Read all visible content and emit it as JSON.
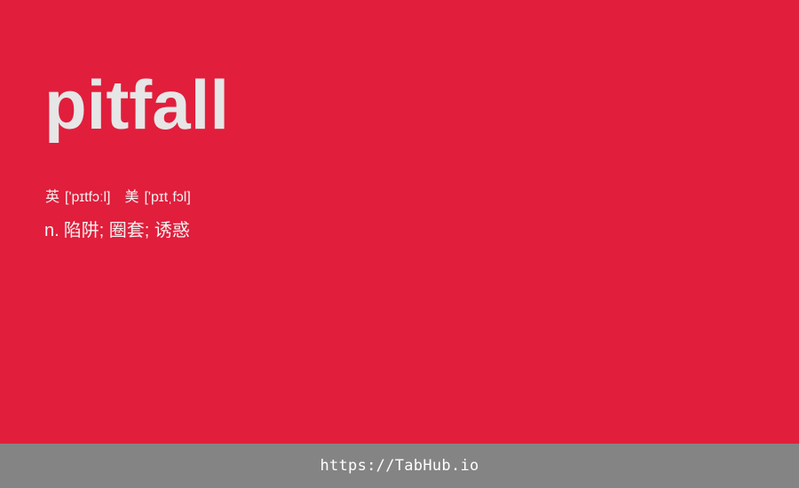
{
  "word": "pitfall",
  "phonetics": {
    "uk_label": "英",
    "uk_ipa": "['pɪtfɔːl]",
    "us_label": "美",
    "us_ipa": "['pɪtˌfɔl]"
  },
  "definition": {
    "part_of_speech": "n.",
    "meaning": "陷阱; 圈套; 诱惑"
  },
  "footer": {
    "link_text": "https://TabHub.io"
  },
  "colors": {
    "background": "#e11e3c",
    "footer_background": "#848484",
    "word_color": "#e6e6e6"
  }
}
